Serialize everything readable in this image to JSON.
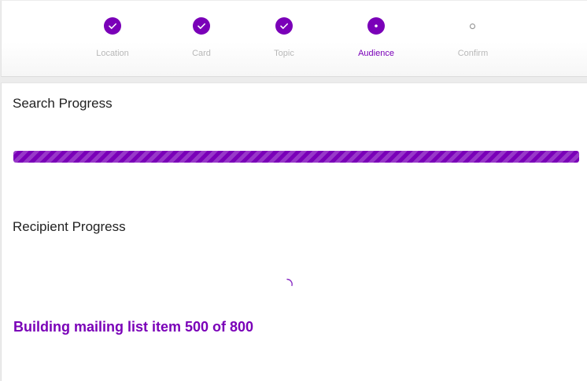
{
  "stepper": {
    "steps": [
      {
        "label": "Location",
        "state": "complete"
      },
      {
        "label": "Card",
        "state": "complete"
      },
      {
        "label": "Topic",
        "state": "complete"
      },
      {
        "label": "Audience",
        "state": "active"
      },
      {
        "label": "Confirm",
        "state": "pending"
      }
    ]
  },
  "search_progress": {
    "title": "Search Progress",
    "value_percent": 100
  },
  "recipient_progress": {
    "title": "Recipient Progress",
    "status_text": "Building mailing list item 500 of 800"
  },
  "colors": {
    "accent": "#7a00b8",
    "inactive_label": "#b8b8b8",
    "heading": "#222222"
  }
}
